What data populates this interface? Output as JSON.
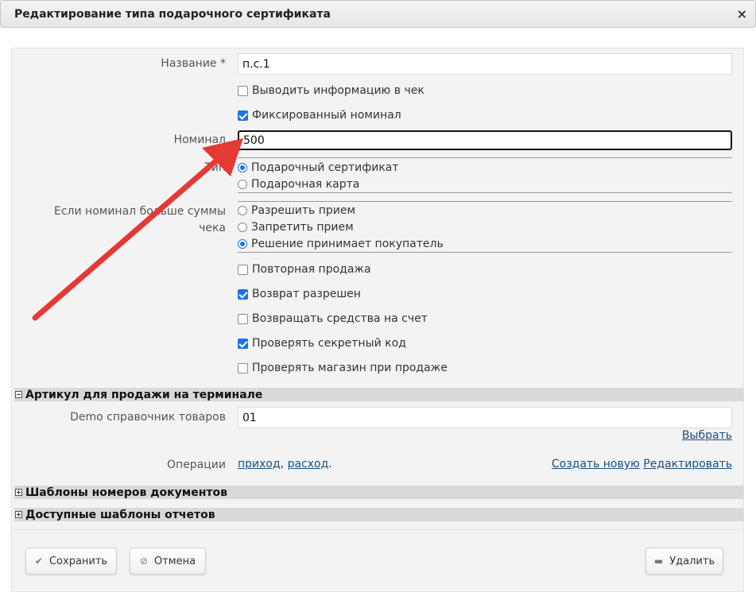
{
  "window": {
    "title": "Редактирование типа подарочного сертификата",
    "close_icon": "×"
  },
  "form": {
    "name_label": "Название *",
    "name_value": "п.с.1",
    "print_info_label": "Выводить информацию в чек",
    "print_info_checked": false,
    "fixed_nominal_label": "Фиксированный номинал",
    "fixed_nominal_checked": true,
    "nominal_label": "Номинал",
    "nominal_value": "500",
    "type_label": "Тип",
    "type_options": [
      "Подарочный сертификат",
      "Подарочная карта"
    ],
    "type_selected": 0,
    "exceed_label_line1": "Если номинал больше суммы",
    "exceed_label_line2": "чека",
    "exceed_options": [
      "Разрешить прием",
      "Запретить прием",
      "Решение принимает покупатель"
    ],
    "exceed_selected": 2,
    "checkboxes": [
      {
        "label": "Повторная продажа",
        "checked": false
      },
      {
        "label": "Возврат разрешен",
        "checked": true
      },
      {
        "label": "Возвращать средства на счет",
        "checked": false
      },
      {
        "label": "Проверять секретный код",
        "checked": true
      },
      {
        "label": "Проверять магазин при продаже",
        "checked": false
      }
    ]
  },
  "sections": {
    "article": "Артикул для продажи на терминале",
    "doc_templates": "Шаблоны номеров документов",
    "report_templates": "Доступные шаблоны отчетов"
  },
  "article": {
    "catalog_label": "Demo справочник товаров",
    "catalog_value": "01",
    "choose_link": "Выбрать",
    "operations_label": "Операции",
    "op_income": "приход",
    "op_sep": ",",
    "op_expense": "расход",
    "op_end": ".",
    "create_new_link": "Создать новую",
    "edit_link": "Редактировать"
  },
  "buttons": {
    "save": "Сохранить",
    "cancel": "Отмена",
    "delete": "Удалить"
  },
  "colors": {
    "accent": "#1a73e8",
    "arrow": "#e53935",
    "link": "#1f4d7a"
  }
}
